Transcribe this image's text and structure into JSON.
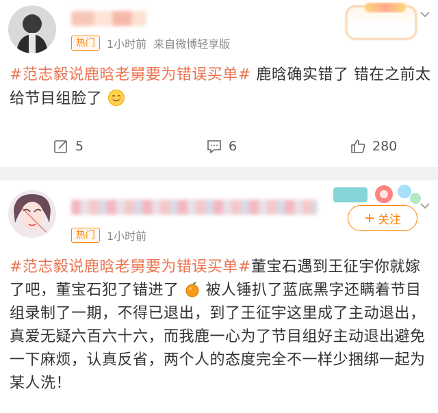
{
  "post1": {
    "hot_label": "热门",
    "time": "1小时前",
    "source": "来自微博轻享版",
    "topic": "#范志毅说鹿晗老舅要为错误买单#",
    "text": "鹿晗确实错了 错在之前太给节目组脸了",
    "emoji": "smile-emoji",
    "repost_count": "5",
    "comment_count": "6",
    "like_count": "280"
  },
  "post2": {
    "hot_label": "热门",
    "time": "1小时前",
    "follow_label": "关注",
    "topic": "#范志毅说鹿晗老舅要为错误买单#",
    "text_part1": "董宝石遇到王征宇你就嫁了吧，董宝石犯了错进了",
    "emoji": "orange-emoji",
    "text_part2": "被人锤扒了蓝底黑字还瞒着节目组录制了一期，不得已退出，到了王征宇这里成了主动退出，真爱无疑六百六十六，而我鹿一心为了节目组好主动退出避免一下麻烦，认真反省，两个人的态度完全不一样少捆绑一起为某人洗！"
  },
  "colors": {
    "accent": "#ff8200",
    "topic": "#eb7350",
    "separator": "#f2f2f2"
  }
}
